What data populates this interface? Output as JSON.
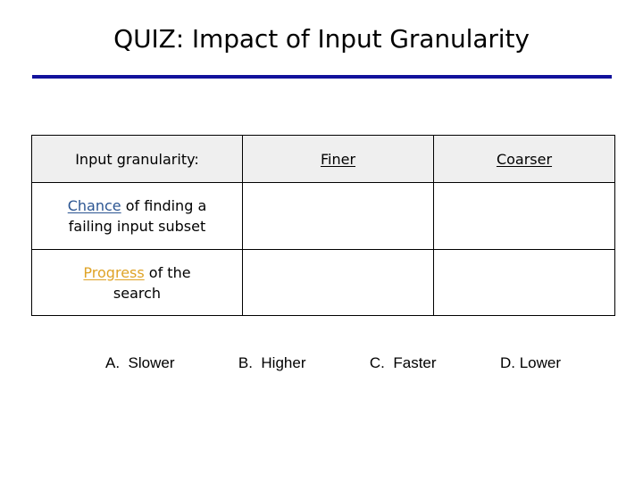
{
  "slide": {
    "title": "QUIZ: Impact of Input Granularity",
    "rule_color": "#12129c"
  },
  "table": {
    "header": {
      "label": "Input granularity:",
      "col_finer": "Finer",
      "col_coarser": "Coarser"
    },
    "rows": [
      {
        "label_keyword": "Chance",
        "label_keyword_color": "#2b5592",
        "label_rest_line1": " of finding a",
        "label_line2": "failing input subset",
        "finer": "",
        "coarser": ""
      },
      {
        "label_keyword": "Progress",
        "label_keyword_color": "#dfa326",
        "label_rest_line1": " of the",
        "label_line2": "search",
        "finer": "",
        "coarser": ""
      }
    ]
  },
  "options": [
    {
      "key": "A.",
      "text": "Slower"
    },
    {
      "key": "B.",
      "text": "Higher"
    },
    {
      "key": "C.",
      "text": "Faster"
    },
    {
      "key": "D.",
      "text": "Lower"
    }
  ]
}
